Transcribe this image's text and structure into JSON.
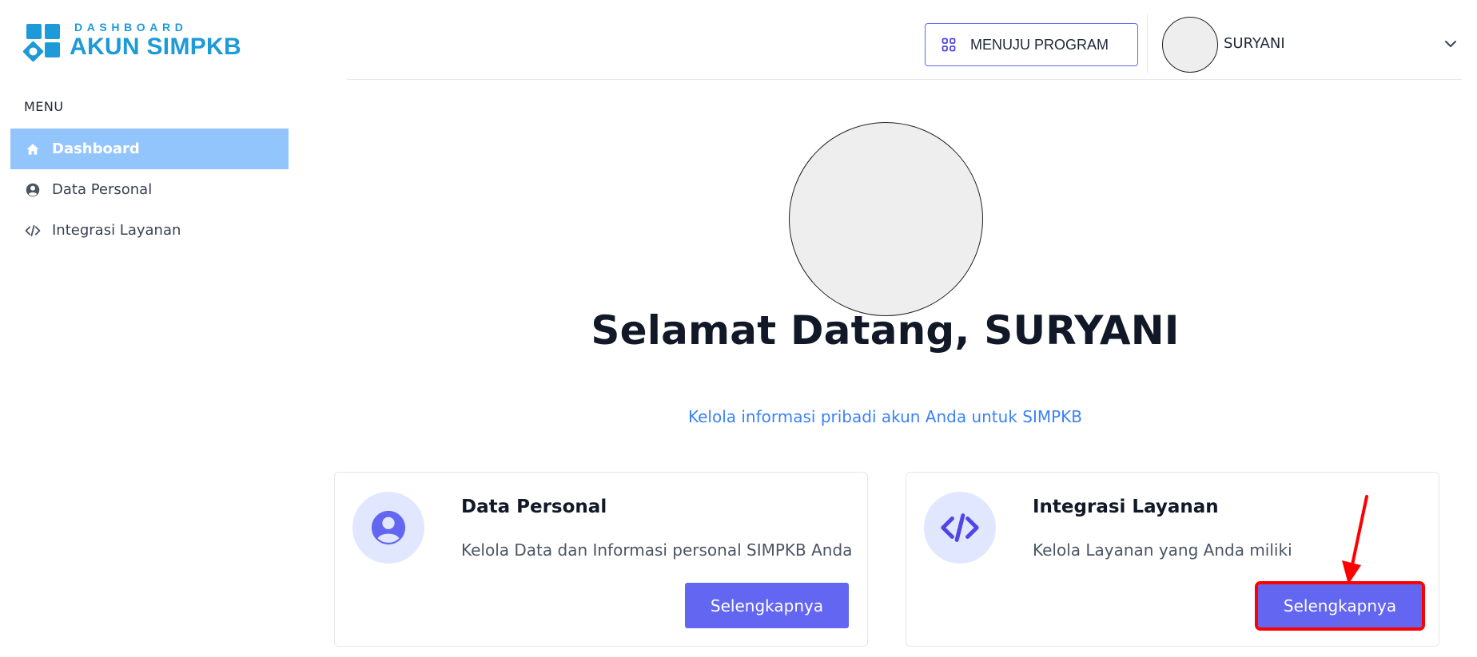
{
  "brand": {
    "subtitle": "DASHBOARD",
    "title": "AKUN SIMPKB",
    "color": "#1d9ad8"
  },
  "sidebar": {
    "heading": "MENU",
    "items": [
      {
        "label": "Dashboard",
        "icon": "home-icon",
        "active": true
      },
      {
        "label": "Data Personal",
        "icon": "user-circle-icon",
        "active": false
      },
      {
        "label": "Integrasi Layanan",
        "icon": "code-icon",
        "active": false
      }
    ]
  },
  "header": {
    "program_button": "MENUJU PROGRAM",
    "user_name": "SURYANI"
  },
  "hero": {
    "greeting": "Selamat Datang,",
    "name": "SURYANI",
    "tagline": "Kelola informasi pribadi akun Anda untuk SIMPKB"
  },
  "cards": [
    {
      "title": "Data Personal",
      "description": "Kelola Data dan Informasi personal SIMPKB Anda",
      "button": "Selengkapnya",
      "icon": "user-circle-icon"
    },
    {
      "title": "Integrasi Layanan",
      "description": "Kelola Layanan yang Anda miliki",
      "button": "Selengkapnya",
      "icon": "code-icon"
    }
  ],
  "colors": {
    "accent": "#6366f1",
    "active_nav": "#93c5fd",
    "link": "#3b82f6",
    "highlight": "#ff0000"
  }
}
